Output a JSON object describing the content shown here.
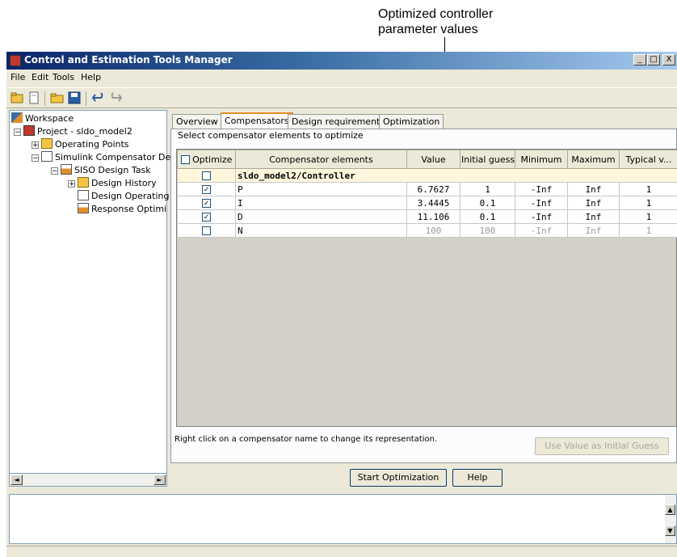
{
  "annotation": {
    "line1": "Optimized controller",
    "line2": "parameter values"
  },
  "window": {
    "title": "Control and Estimation Tools Manager",
    "controls": {
      "minimize": "_",
      "maximize": "□",
      "close": "X"
    }
  },
  "menu": [
    "File",
    "Edit",
    "Tools",
    "Help"
  ],
  "toolbar": {
    "icons": [
      "new-project-icon",
      "new-task-icon",
      "open-icon",
      "save-icon",
      "undo-icon",
      "redo-icon"
    ]
  },
  "tree": {
    "items": [
      {
        "label": "Workspace",
        "icon": "workspace-icon"
      },
      {
        "label": "Project - sldo_model2",
        "icon": "project-icon"
      },
      {
        "label": "Operating Points",
        "icon": "folder-icon"
      },
      {
        "label": "Simulink Compensator De",
        "icon": "compensator-icon"
      },
      {
        "label": "SISO Design Task",
        "icon": "task-icon"
      },
      {
        "label": "Design History",
        "icon": "folder-icon"
      },
      {
        "label": "Design Operating",
        "icon": "plot-icon"
      },
      {
        "label": "Response Optimi",
        "icon": "response-icon"
      }
    ],
    "expanders": [
      "−",
      "+",
      "−",
      "−",
      "+"
    ]
  },
  "tabs": [
    "Overview",
    "Compensators",
    "Design requirements",
    "Optimization"
  ],
  "active_tab": "Compensators",
  "group_label": "Select compensator elements to optimize",
  "table": {
    "headers": {
      "optimize": "Optimize",
      "elements": "Compensator elements",
      "value": "Value",
      "initial": "Initial guess",
      "minimum": "Minimum",
      "maximum": "Maximum",
      "typical": "Typical v..."
    },
    "group_row": "sldo_model2/Controller",
    "rows": [
      {
        "optimize": "✓",
        "name": "P",
        "value": "6.7627",
        "initial": "1",
        "minimum": "-Inf",
        "maximum": "Inf",
        "typical": "1"
      },
      {
        "optimize": "✓",
        "name": "I",
        "value": "3.4445",
        "initial": "0.1",
        "minimum": "-Inf",
        "maximum": "Inf",
        "typical": "1"
      },
      {
        "optimize": "✓",
        "name": "D",
        "value": "11.106",
        "initial": "0.1",
        "minimum": "-Inf",
        "maximum": "Inf",
        "typical": "1"
      },
      {
        "optimize": "",
        "name": "N",
        "value": "100",
        "initial": "100",
        "minimum": "-Inf",
        "maximum": "Inf",
        "typical": "1"
      }
    ]
  },
  "status_text": "Right click on a compensator name to change its representation.",
  "buttons": {
    "use_value": "Use Value as Initial Guess",
    "start": "Start Optimization",
    "help": "Help"
  },
  "scroll": {
    "left": "◄",
    "right": "►",
    "up": "▲",
    "down": "▼"
  }
}
